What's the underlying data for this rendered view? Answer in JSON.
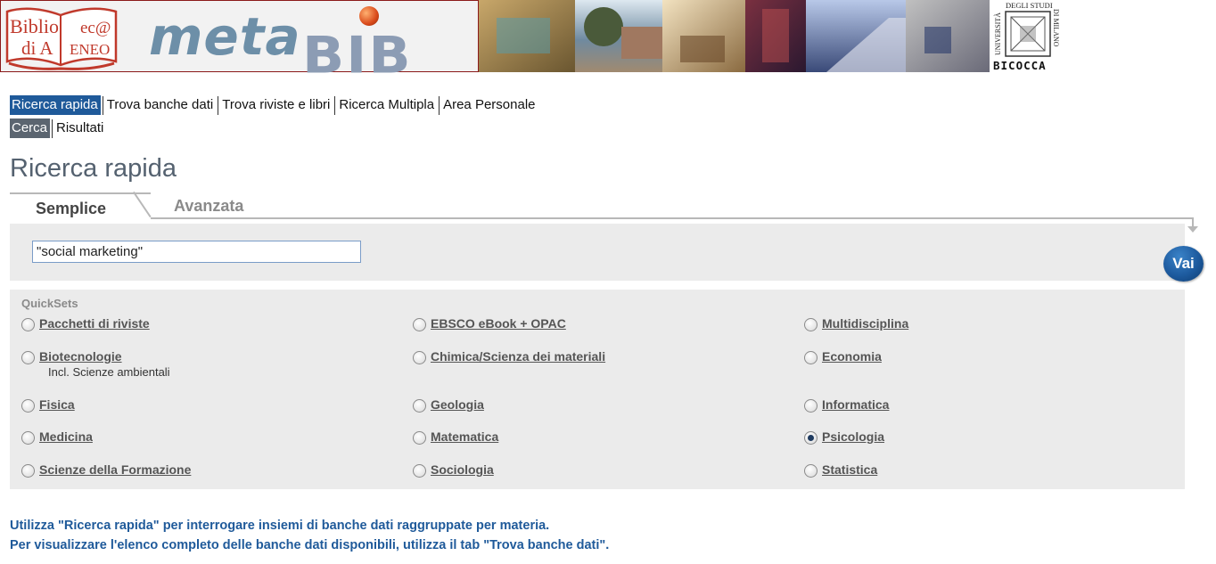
{
  "banner": {
    "biblio_logo_text_1": "Biblio",
    "biblio_logo_text_2": "ec@",
    "biblio_logo_text_3": "di A",
    "biblio_logo_text_4": "ENEO",
    "metabib_meta": "meta",
    "metabib_bib": "BIB",
    "university_line_1": "UNIVERSITÀ",
    "university_line_2": "DEGLI STUDI",
    "university_line_3": "DI MILANO",
    "university_name": "BICOCCA"
  },
  "nav": {
    "primary": [
      {
        "label": "Ricerca rapida",
        "active": true
      },
      {
        "label": "Trova banche dati",
        "active": false
      },
      {
        "label": "Trova riviste e libri",
        "active": false
      },
      {
        "label": "Ricerca Multipla",
        "active": false
      },
      {
        "label": "Area Personale",
        "active": false
      }
    ],
    "secondary": [
      {
        "label": "Cerca",
        "active": true
      },
      {
        "label": "Risultati",
        "active": false
      }
    ]
  },
  "page": {
    "title": "Ricerca rapida"
  },
  "tabs": {
    "simple": "Semplice",
    "advanced": "Avanzata"
  },
  "search": {
    "value": "\"social marketing\"",
    "go_label": "Vai"
  },
  "quicksets": {
    "heading": "QuickSets",
    "items": [
      {
        "label": "Pacchetti di riviste",
        "checked": false
      },
      {
        "label": "EBSCO eBook + OPAC",
        "checked": false
      },
      {
        "label": "Multidisciplina",
        "checked": false
      },
      {
        "label": "Biotecnologie",
        "checked": false,
        "sub": "Incl. Scienze ambientali"
      },
      {
        "label": "Chimica/Scienza dei materiali",
        "checked": false
      },
      {
        "label": "Economia",
        "checked": false
      },
      {
        "label": "Fisica",
        "checked": false
      },
      {
        "label": "Geologia",
        "checked": false
      },
      {
        "label": "Informatica",
        "checked": false
      },
      {
        "label": "Medicina",
        "checked": false
      },
      {
        "label": "Matematica",
        "checked": false
      },
      {
        "label": "Psicologia",
        "checked": true
      },
      {
        "label": "Scienze della Formazione",
        "checked": false
      },
      {
        "label": "Sociologia",
        "checked": false
      },
      {
        "label": "Statistica",
        "checked": false
      }
    ]
  },
  "info": {
    "line1": "Utilizza \"Ricerca rapida\" per interrogare insiemi di banche dati raggruppate per materia.",
    "line2": "Per visualizzare l'elenco completo delle banche dati disponibili, utilizza il tab \"Trova banche dati\"."
  },
  "colors": {
    "nav_active": "#1f5a9a",
    "nav_active_secondary": "#5b6570",
    "panel_bg": "#ebebeb",
    "info_text": "#1f5a9a",
    "banner_border": "#8b1a1a"
  }
}
